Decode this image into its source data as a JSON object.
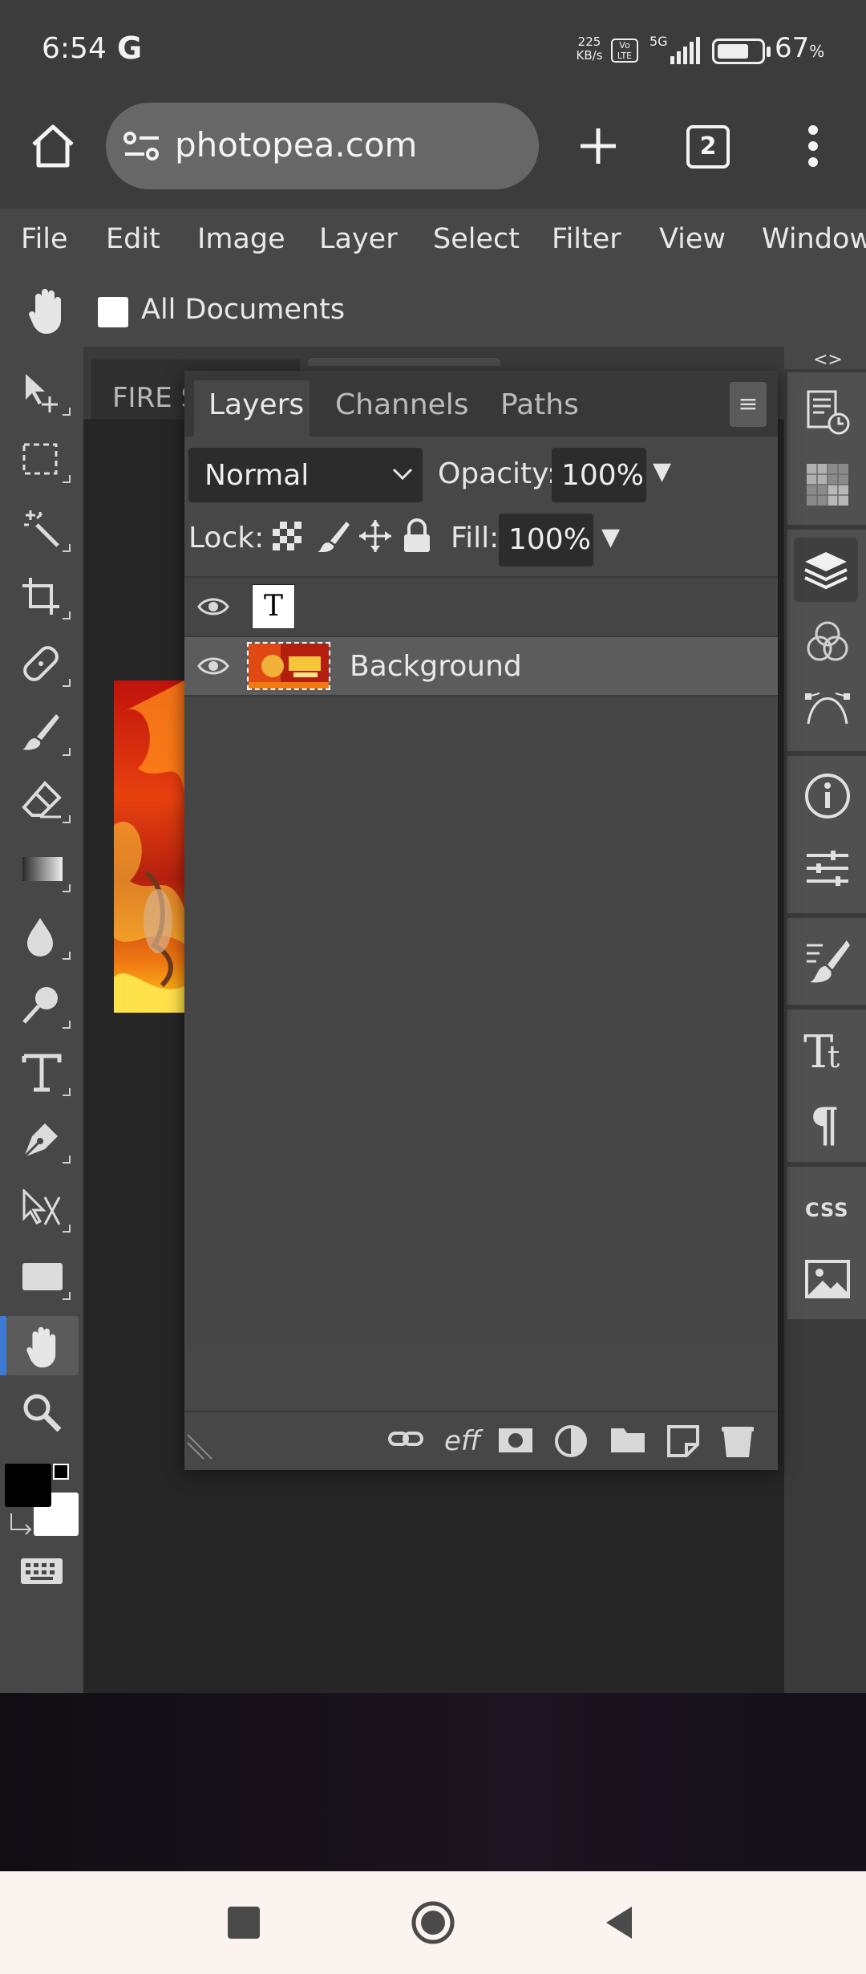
{
  "status_bar": {
    "time": "6:54",
    "g_label": "G",
    "speed_value": "225",
    "speed_unit": "KB/s",
    "volte": "Vo LTE",
    "network": "5G",
    "battery_percent": "67",
    "battery_symbol": "%"
  },
  "browser": {
    "url": "photopea.com",
    "tab_count": "2"
  },
  "menu": {
    "items": [
      "File",
      "Edit",
      "Image",
      "Layer",
      "Select",
      "Filter",
      "View",
      "Window"
    ]
  },
  "options_bar": {
    "all_documents_label": "All Documents",
    "all_documents_checked": false
  },
  "document": {
    "tab_title": "FIRE S"
  },
  "panel_toggle": "<>",
  "layers_panel": {
    "tabs": [
      "Layers",
      "Channels",
      "Paths"
    ],
    "active_tab": "Layers",
    "menu_icon": "≡",
    "blend_mode": "Normal",
    "opacity_label": "Opacity:",
    "opacity_value": "100%",
    "lock_label": "Lock:",
    "fill_label": "Fill:",
    "fill_value": "100%",
    "dropdown_arrow": "▼",
    "layers": [
      {
        "type": "text",
        "thumb": "T",
        "name": "",
        "visible": true,
        "selected": false
      },
      {
        "type": "image",
        "thumb": "",
        "name": "Background",
        "visible": true,
        "selected": true
      }
    ],
    "footer_effects_label": "eff"
  },
  "colors": {
    "ui_bg": "#474747",
    "panel_bg": "#454545",
    "selected_row": "#5c5c5c",
    "accent": "#3d7ad6",
    "foreground_color": "#000000",
    "background_color": "#ffffff"
  }
}
